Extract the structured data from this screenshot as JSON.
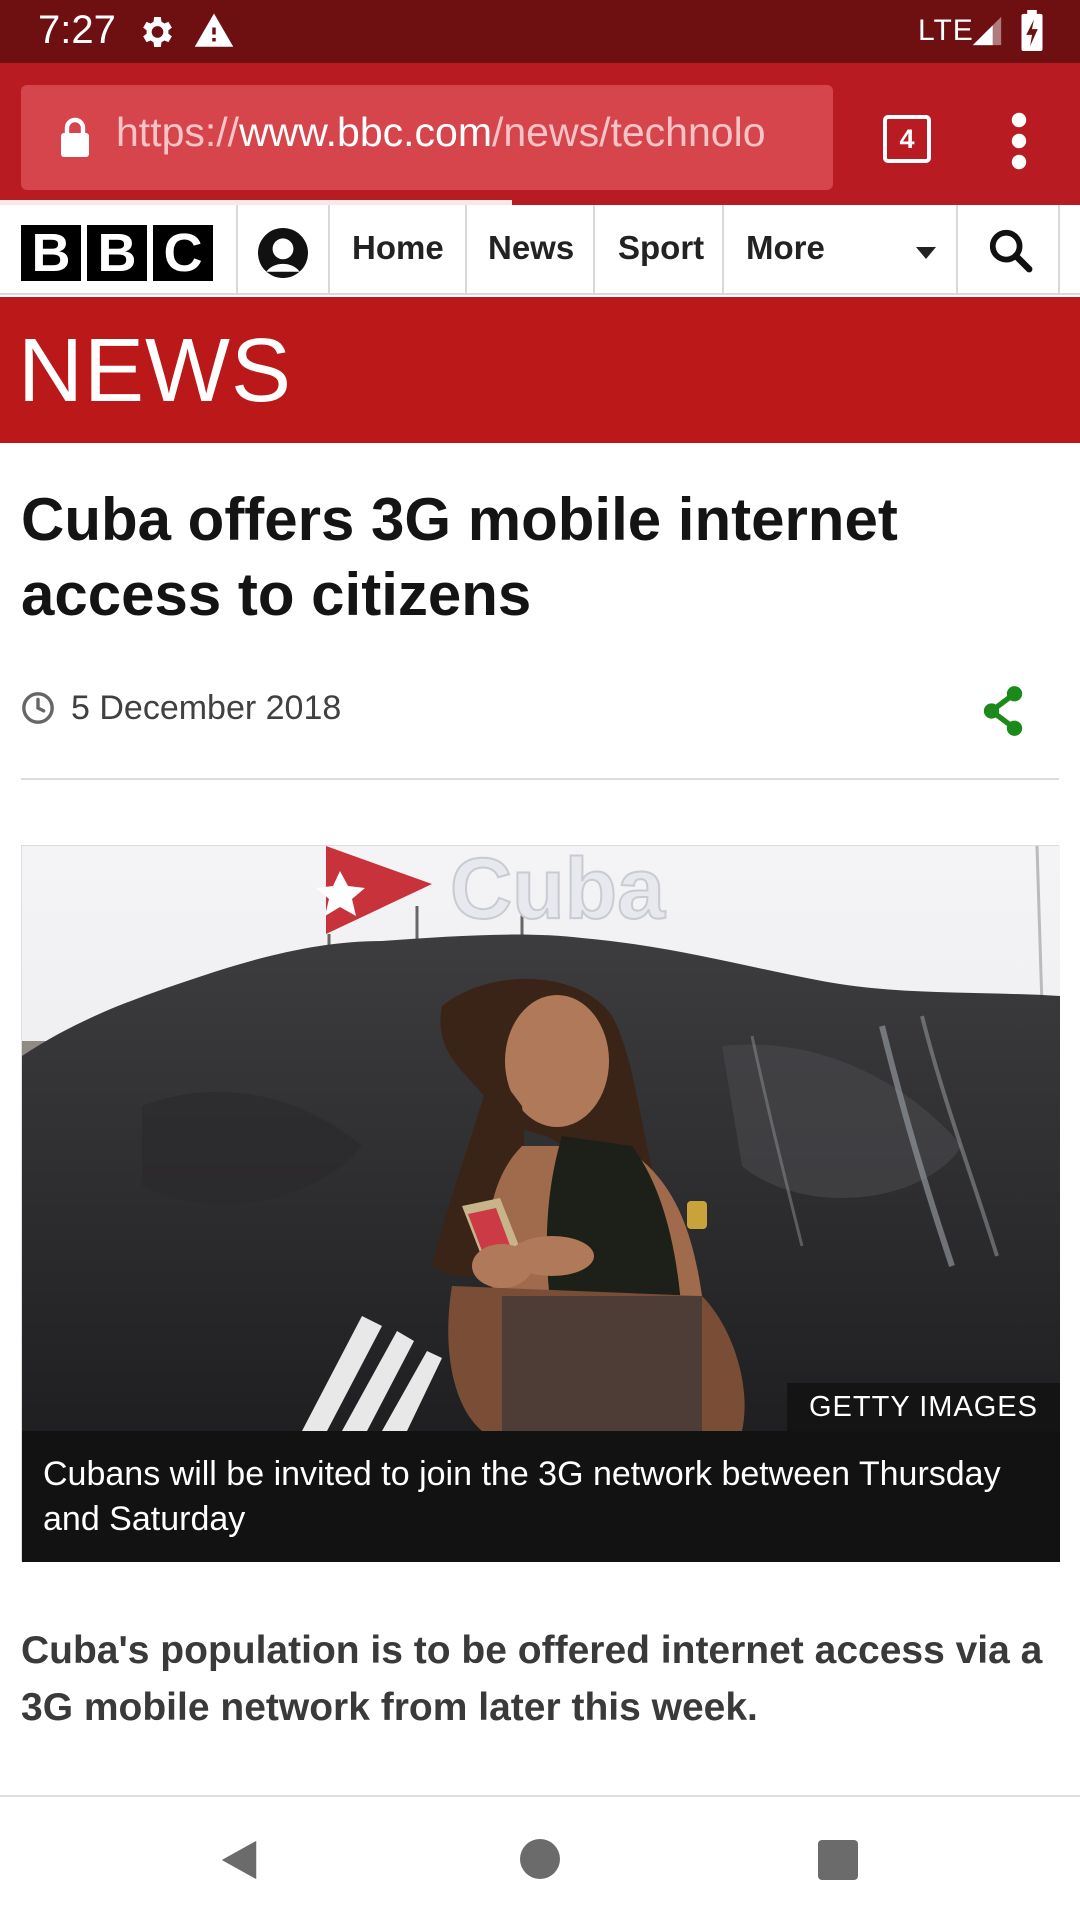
{
  "status_bar": {
    "time": "7:27",
    "network": "LTE",
    "icons": [
      "gear-icon",
      "warning-icon",
      "signal-icon",
      "battery-charging-icon"
    ]
  },
  "browser": {
    "url_scheme": "https://",
    "url_host": "www.bbc.com",
    "url_path": "/news/technolo",
    "tab_count": "4",
    "theme_color": "#b81c22",
    "icons": [
      "lock-icon",
      "overflow-menu-icon"
    ]
  },
  "site_nav": {
    "logo_letters": [
      "B",
      "B",
      "C"
    ],
    "links": [
      "Home",
      "News",
      "Sport",
      "More"
    ],
    "icons": [
      "account-icon",
      "caret-down-icon",
      "search-icon"
    ]
  },
  "banner": {
    "title": "NEWS",
    "color": "#bb1919"
  },
  "article": {
    "headline": "Cuba offers 3G mobile internet access to citizens",
    "date": "5 December 2018",
    "image_credit": "GETTY IMAGES",
    "image_caption": "Cubans will be invited to join the 3G network between Thursday and Saturday",
    "lede": "Cuba's population is to be offered internet access via a 3G mobile network from later this week.",
    "share_color": "#1a8a1a"
  },
  "photo_sign_text": "Cuba",
  "system_nav": {
    "icons": [
      "back-icon",
      "home-icon",
      "recents-icon"
    ]
  }
}
